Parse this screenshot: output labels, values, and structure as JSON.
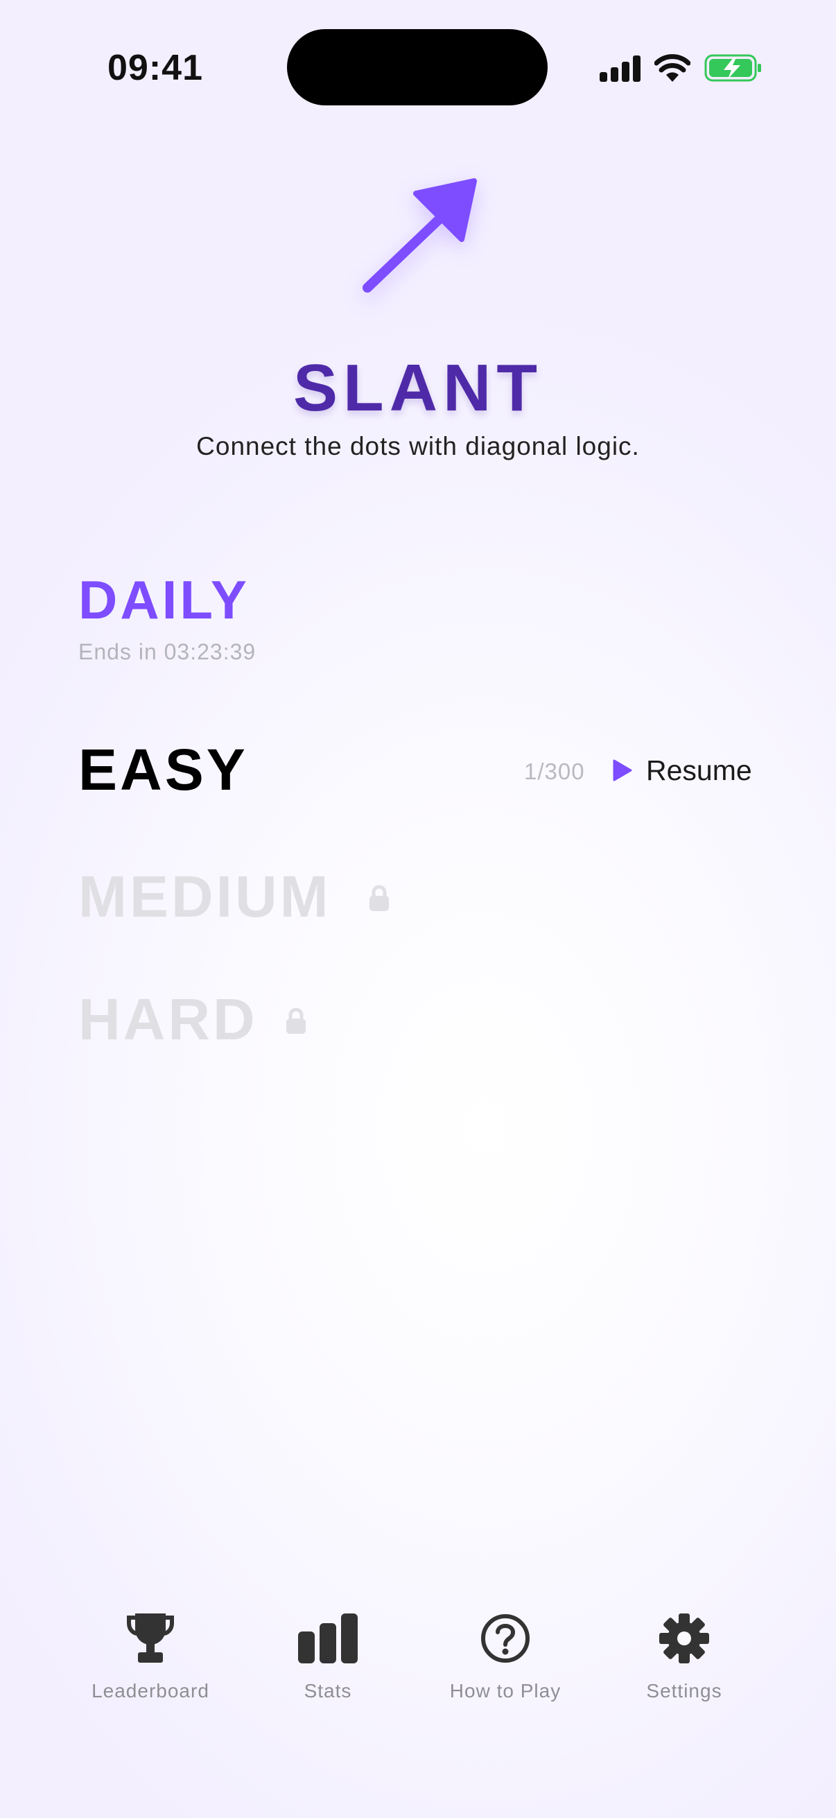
{
  "status_bar": {
    "time": "09:41",
    "battery_color": "#34c759"
  },
  "app": {
    "title": "SLANT",
    "tagline": "Connect the dots with diagonal logic.",
    "accent_color": "#7d4dff",
    "logo_icon": "diagonal-arrow-icon"
  },
  "modes": {
    "daily": {
      "label": "DAILY",
      "countdown": "Ends in 03:23:39"
    },
    "easy": {
      "label": "EASY",
      "progress": "1/300",
      "action": "Resume"
    },
    "medium": {
      "label": "MEDIUM",
      "locked": true
    },
    "hard": {
      "label": "HARD",
      "locked": true
    }
  },
  "tabs": [
    {
      "label": "Leaderboard",
      "icon": "trophy-icon"
    },
    {
      "label": "Stats",
      "icon": "bar-chart-icon"
    },
    {
      "label": "How to Play",
      "icon": "question-icon"
    },
    {
      "label": "Settings",
      "icon": "gear-icon"
    }
  ]
}
